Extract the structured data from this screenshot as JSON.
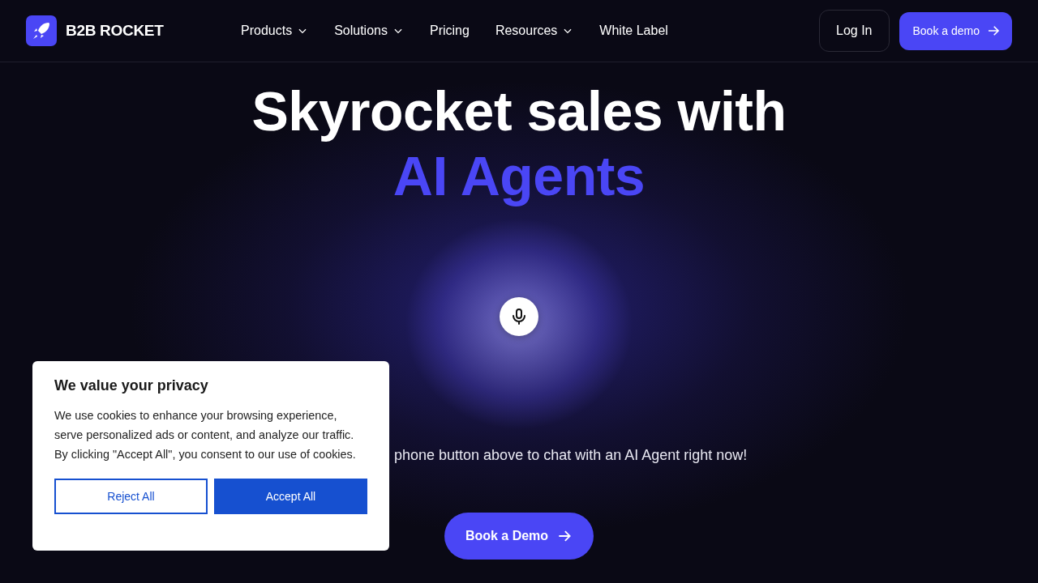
{
  "header": {
    "logo_text": "B2B ROCKET",
    "nav": [
      {
        "label": "Products",
        "has_menu": true
      },
      {
        "label": "Solutions",
        "has_menu": true
      },
      {
        "label": "Pricing",
        "has_menu": false
      },
      {
        "label": "Resources",
        "has_menu": true
      },
      {
        "label": "White Label",
        "has_menu": false
      }
    ],
    "login": "Log In",
    "demo_button": "Book a demo"
  },
  "hero": {
    "title": "Skyrocket sales with",
    "title_accent": "AI Agents",
    "subtitle": "phone button above to chat with an AI Agent right now!",
    "cta": "Book a Demo"
  },
  "cookie_banner": {
    "title": "We value your privacy",
    "text": "We use cookies to enhance your browsing experience, serve personalized ads or content, and analyze our traffic. By clicking \"Accept All\", you consent to our use of cookies.",
    "buttons": [
      {
        "label": "Reject All",
        "kind": "outline"
      },
      {
        "label": "Accept All",
        "kind": "filled"
      }
    ]
  }
}
